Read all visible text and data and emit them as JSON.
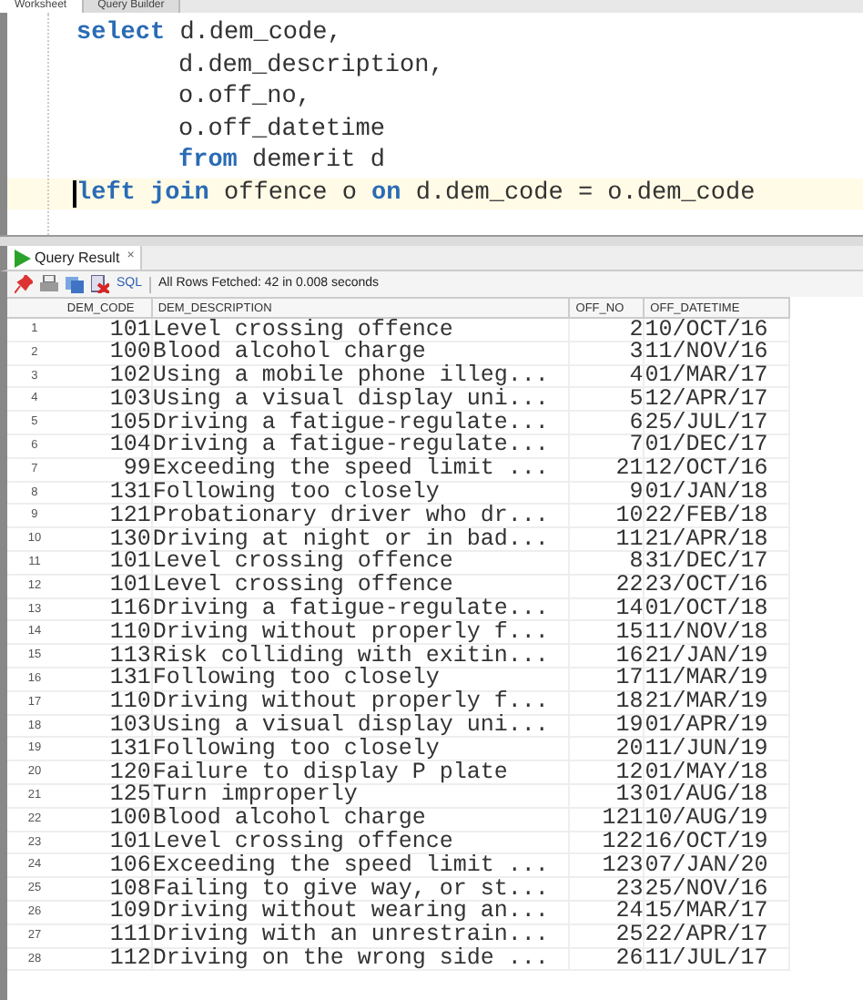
{
  "editor_tabs": [
    {
      "label": "Worksheet",
      "selected": true
    },
    {
      "label": "Query Builder",
      "selected": false
    }
  ],
  "editor": {
    "lines": [
      {
        "current": false,
        "tokens": [
          {
            "text": "select",
            "keyword": true
          },
          {
            "text": " d.dem_code,",
            "keyword": false
          }
        ],
        "children": [
          {
            "current": false,
            "tokens": [
              {
                "text": "d.dem_description,",
                "keyword": false
              }
            ]
          },
          {
            "current": false,
            "tokens": [
              {
                "text": "o.off_no,",
                "keyword": false
              }
            ]
          },
          {
            "current": false,
            "tokens": [
              {
                "text": "o.off_datetime",
                "keyword": false
              }
            ]
          },
          {
            "current": false,
            "tokens": [
              {
                "text": "from",
                "keyword": true
              },
              {
                "text": " demerit d",
                "keyword": false
              }
            ]
          }
        ]
      },
      {
        "current": true,
        "tokens": [
          {
            "text": "left join",
            "keyword": true
          },
          {
            "text": " offence o ",
            "keyword": false
          },
          {
            "text": "on",
            "keyword": true
          },
          {
            "text": " d.dem_code = o.dem_code",
            "keyword": false
          }
        ]
      }
    ]
  },
  "result_tab": {
    "label": "Query Result",
    "close": "×"
  },
  "toolbar": {
    "sql_link": "SQL",
    "status": "All Rows Fetched: 42 in 0.008 seconds"
  },
  "table": {
    "columns": [
      "",
      "DEM_CODE",
      "DEM_DESCRIPTION",
      "OFF_NO",
      "OFF_DATETIME"
    ],
    "rows": [
      [
        "1",
        "101",
        "Level crossing offence",
        "2",
        "10/OCT/16"
      ],
      [
        "2",
        "100",
        "Blood alcohol charge",
        "3",
        "11/NOV/16"
      ],
      [
        "3",
        "102",
        "Using a mobile phone illeg...",
        "4",
        "01/MAR/17"
      ],
      [
        "4",
        "103",
        "Using a visual display uni...",
        "5",
        "12/APR/17"
      ],
      [
        "5",
        "105",
        "Driving a fatigue-regulate...",
        "6",
        "25/JUL/17"
      ],
      [
        "6",
        "104",
        "Driving a fatigue-regulate...",
        "7",
        "01/DEC/17"
      ],
      [
        "7",
        "99",
        "Exceeding the speed limit ...",
        "21",
        "12/OCT/16"
      ],
      [
        "8",
        "131",
        "Following too closely",
        "9",
        "01/JAN/18"
      ],
      [
        "9",
        "121",
        "Probationary driver who dr...",
        "10",
        "22/FEB/18"
      ],
      [
        "10",
        "130",
        "Driving at night or in bad...",
        "11",
        "21/APR/18"
      ],
      [
        "11",
        "101",
        "Level crossing offence",
        "8",
        "31/DEC/17"
      ],
      [
        "12",
        "101",
        "Level crossing offence",
        "22",
        "23/OCT/16"
      ],
      [
        "13",
        "116",
        "Driving a fatigue-regulate...",
        "14",
        "01/OCT/18"
      ],
      [
        "14",
        "110",
        "Driving without properly f...",
        "15",
        "11/NOV/18"
      ],
      [
        "15",
        "113",
        "Risk colliding with exitin...",
        "16",
        "21/JAN/19"
      ],
      [
        "16",
        "131",
        "Following too closely",
        "17",
        "11/MAR/19"
      ],
      [
        "17",
        "110",
        "Driving without properly f...",
        "18",
        "21/MAR/19"
      ],
      [
        "18",
        "103",
        "Using a visual display uni...",
        "19",
        "01/APR/19"
      ],
      [
        "19",
        "131",
        "Following too closely",
        "20",
        "11/JUN/19"
      ],
      [
        "20",
        "120",
        "Failure to display P plate",
        "12",
        "01/MAY/18"
      ],
      [
        "21",
        "125",
        "Turn improperly",
        "13",
        "01/AUG/18"
      ],
      [
        "22",
        "100",
        "Blood alcohol charge",
        "121",
        "10/AUG/19"
      ],
      [
        "23",
        "101",
        "Level crossing offence",
        "122",
        "16/OCT/19"
      ],
      [
        "24",
        "106",
        "Exceeding the speed limit ...",
        "123",
        "07/JAN/20"
      ],
      [
        "25",
        "108",
        "Failing to give way, or st...",
        "23",
        "25/NOV/16"
      ],
      [
        "26",
        "109",
        "Driving without wearing an...",
        "24",
        "15/MAR/17"
      ],
      [
        "27",
        "111",
        "Driving with an unrestrain...",
        "25",
        "22/APR/17"
      ],
      [
        "28",
        "112",
        "Driving on the wrong side ...",
        "26",
        "11/JUL/17"
      ]
    ]
  }
}
